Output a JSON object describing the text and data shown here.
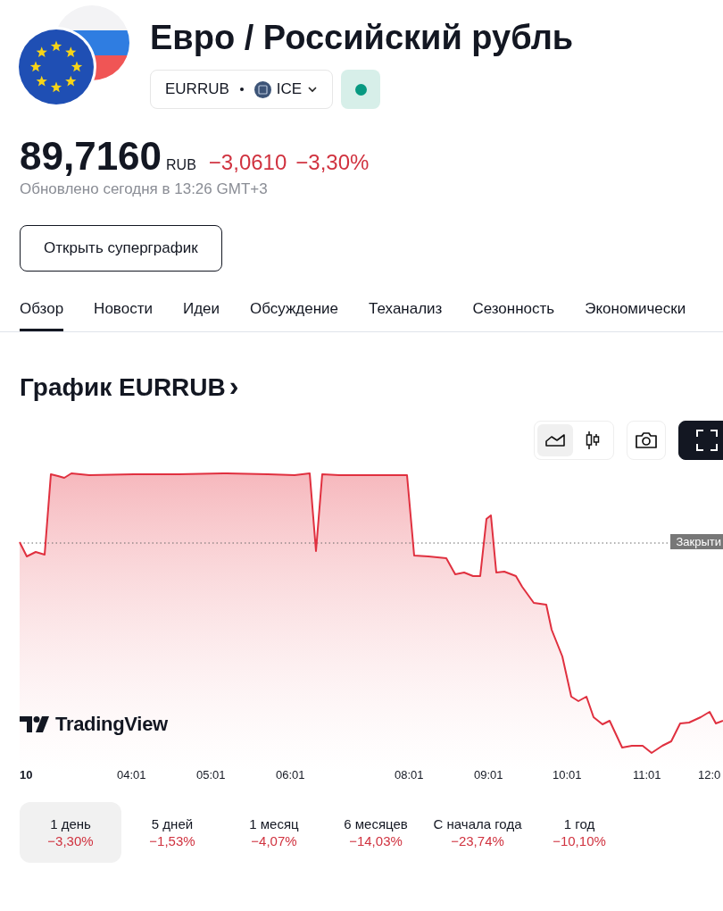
{
  "header": {
    "title": "Евро / Российский рубль",
    "symbol": "EURRUB",
    "exchange": "ICE",
    "market_open": true
  },
  "quote": {
    "price": "89,7160",
    "currency": "RUB",
    "change": "−3,0610",
    "change_percent": "−3,30%",
    "negative": true,
    "updated": "Обновлено сегодня в 13:26 GMT+3"
  },
  "superchart_button": "Открыть суперграфик",
  "tabs": [
    {
      "label": "Обзор",
      "selected": true
    },
    {
      "label": "Новости",
      "selected": false
    },
    {
      "label": "Идеи",
      "selected": false
    },
    {
      "label": "Обсуждение",
      "selected": false
    },
    {
      "label": "Теханализ",
      "selected": false
    },
    {
      "label": "Сезонность",
      "selected": false
    },
    {
      "label": "Экономически",
      "selected": false
    }
  ],
  "chart": {
    "title": "График EURRUB",
    "chevron": "›",
    "chart_types": [
      {
        "kind": "area",
        "selected": true
      },
      {
        "kind": "candles",
        "selected": false
      }
    ],
    "close_label": "Закрыти",
    "brand": "TradingView",
    "x_labels": [
      "10",
      "04:01",
      "05:01",
      "06:01",
      "08:01",
      "09:01",
      "10:01",
      "11:01",
      "12:0"
    ]
  },
  "periods": [
    {
      "label": "1 день",
      "change": "−3,30%",
      "negative": true,
      "selected": true
    },
    {
      "label": "5 дней",
      "change": "−1,53%",
      "negative": true,
      "selected": false
    },
    {
      "label": "1 месяц",
      "change": "−4,07%",
      "negative": true,
      "selected": false
    },
    {
      "label": "6 месяцев",
      "change": "−14,03%",
      "negative": true,
      "selected": false
    },
    {
      "label": "С начала года",
      "change": "−23,74%",
      "negative": true,
      "selected": false
    },
    {
      "label": "1 год",
      "change": "−10,10%",
      "negative": true,
      "selected": false
    }
  ]
}
